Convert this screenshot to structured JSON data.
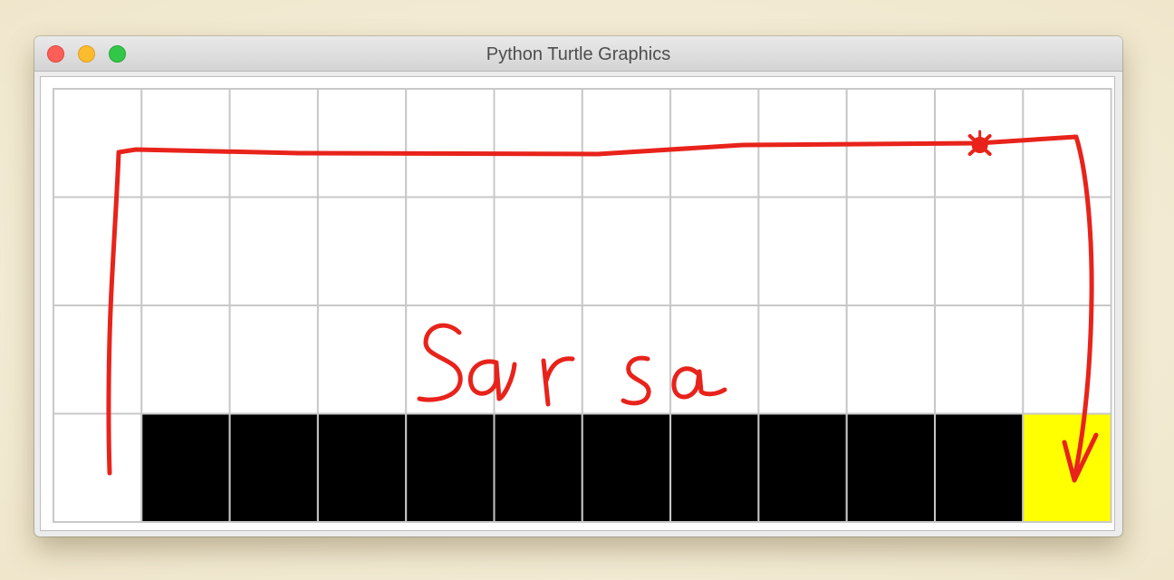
{
  "window": {
    "title": "Python Turtle Graphics",
    "buttons": {
      "close": "close",
      "minimize": "minimize",
      "zoom": "zoom"
    }
  },
  "grid": {
    "rows": 4,
    "cols": 12,
    "cell_states": [
      [
        "empty",
        "empty",
        "empty",
        "empty",
        "empty",
        "empty",
        "empty",
        "empty",
        "empty",
        "empty",
        "empty",
        "empty"
      ],
      [
        "empty",
        "empty",
        "empty",
        "empty",
        "empty",
        "empty",
        "empty",
        "empty",
        "empty",
        "empty",
        "empty",
        "empty"
      ],
      [
        "empty",
        "empty",
        "empty",
        "empty",
        "empty",
        "empty",
        "empty",
        "empty",
        "empty",
        "empty",
        "empty",
        "empty"
      ],
      [
        "empty",
        "cliff",
        "cliff",
        "cliff",
        "cliff",
        "cliff",
        "cliff",
        "cliff",
        "cliff",
        "cliff",
        "cliff",
        "goal"
      ]
    ],
    "colors": {
      "empty": "#ffffff",
      "cliff": "#000000",
      "goal": "#ffff00",
      "grid_line": "#c8c8c8"
    }
  },
  "annotation": {
    "handwritten_label": "Sarsa",
    "ink_color": "#e8231b",
    "path_description": "start bottom-left, up to top row, right along top, down to goal"
  },
  "turtle": {
    "icon": "turtle-icon",
    "color": "#e8231b",
    "row": 0,
    "col": 10
  }
}
